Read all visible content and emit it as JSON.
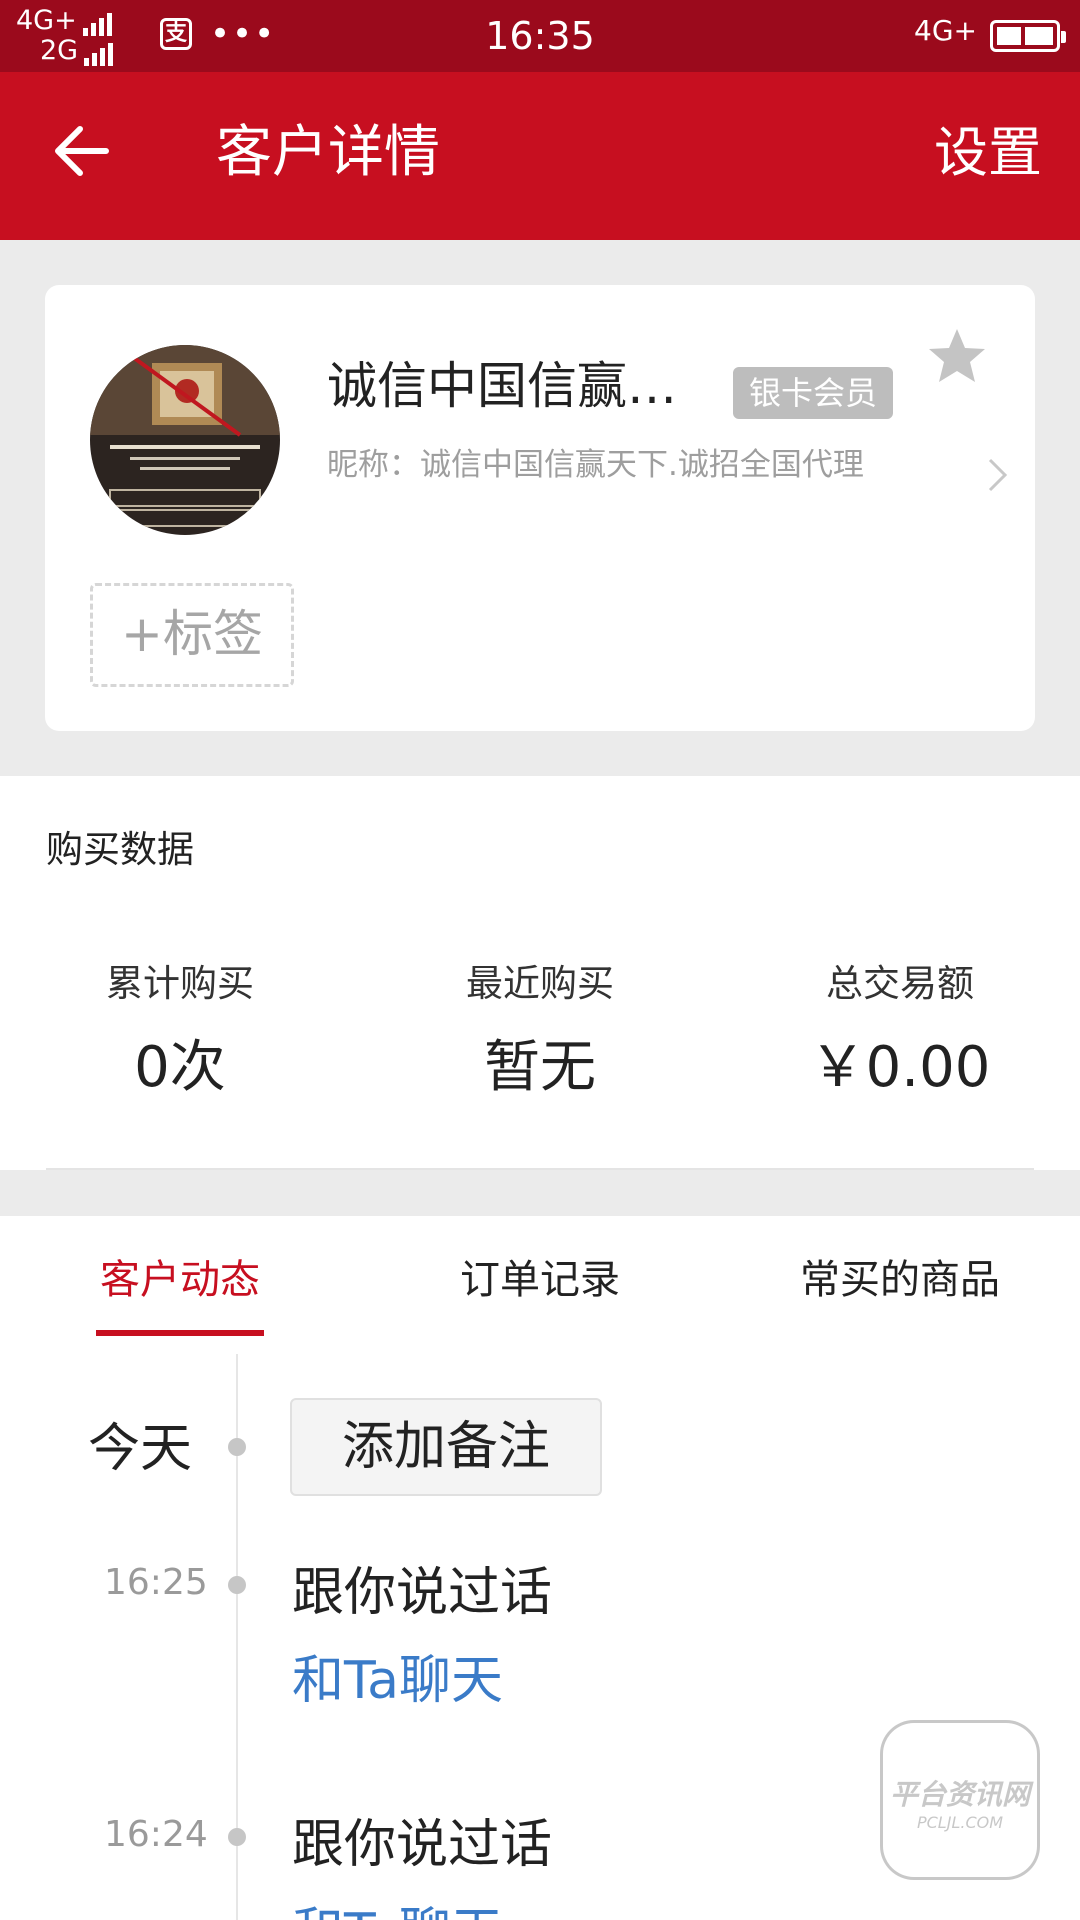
{
  "status_bar": {
    "network_1": "4G+",
    "network_2": "2G",
    "app_icon_label": "支",
    "more": "•••",
    "time": "16:35",
    "network_right": "4G+",
    "battery_icon": "battery-icon"
  },
  "header": {
    "title": "客户详情",
    "settings_label": "设置",
    "back_icon": "arrow-left-icon",
    "bg_color": "#c70f20"
  },
  "profile": {
    "name": "诚信中国信赢…",
    "member_badge": "银卡会员",
    "nickname": "昵称：诚信中国信赢天下.诚招全国代理",
    "add_tag_label": "+标签"
  },
  "purchase": {
    "section_title": "购买数据",
    "stats": [
      {
        "label": "累计购买",
        "value": "0次"
      },
      {
        "label": "最近购买",
        "value": "暂无"
      },
      {
        "label": "总交易额",
        "value": "￥0.00"
      }
    ]
  },
  "tabs": [
    {
      "label": "客户动态",
      "active": true
    },
    {
      "label": "订单记录",
      "active": false
    },
    {
      "label": "常买的商品",
      "active": false
    }
  ],
  "timeline": {
    "today_label": "今天",
    "add_note_label": "添加备注",
    "entries": [
      {
        "time": "16:25",
        "text": "跟你说过话",
        "link": "和Ta聊天"
      },
      {
        "time": "16:24",
        "text": "跟你说过话",
        "link": "和Ta聊天"
      }
    ]
  },
  "watermark": {
    "title": "平台资讯网",
    "sub": "PCLJL.COM"
  },
  "colors": {
    "accent": "#c70f20",
    "link": "#3a7bc8"
  }
}
